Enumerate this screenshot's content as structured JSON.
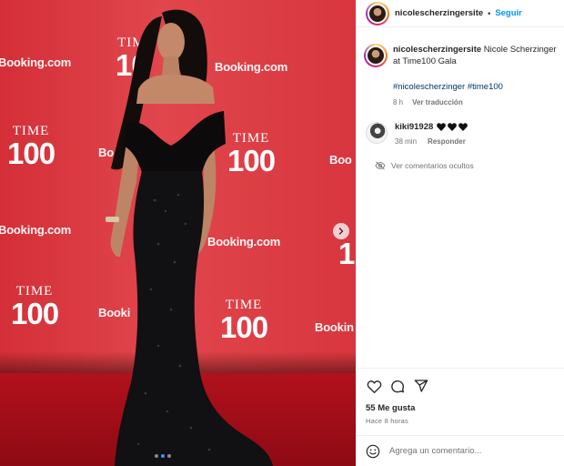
{
  "post": {
    "username": "nicolescherzingersite",
    "separator": "•",
    "follow_label": "Seguir",
    "caption_text": "Nicole Scherzinger at Time100 Gala",
    "hashtags": "#nicolescherzinger #time100",
    "caption_time": "8 h",
    "see_translation": "Ver traducción"
  },
  "media": {
    "booking_text": "Booking.com",
    "booking_partial": "Bookin",
    "booking_partial2": "Booki",
    "booking_cut": "Boo",
    "booking_cut2": "Bo",
    "time_text": "TIME",
    "time_partial": "TIM",
    "hundred_text": "100",
    "hundred_partial": "10",
    "hundred_cut": "1",
    "dot_count": 3,
    "active_dot": 2
  },
  "comment": {
    "username": "kiki91928",
    "hearts": "♥ ♥ ♥",
    "time": "38 min",
    "reply_label": "Responder"
  },
  "hidden_comments_label": "Ver comentarios ocultos",
  "likes": "55 Me gusta",
  "posted_ago": "Hace 8 horas",
  "comment_input": {
    "placeholder": "Agrega un comentario..."
  },
  "icons": {
    "like": "heart-icon",
    "comment": "comment-icon",
    "share": "share-icon",
    "emoji": "emoji-icon",
    "hidden": "eye-off-icon",
    "next": "chevron-right-icon"
  },
  "colors": {
    "link": "#0095f6",
    "hashtag": "#00376b",
    "backdrop": "#d9363e",
    "carpet": "#b2111c"
  }
}
